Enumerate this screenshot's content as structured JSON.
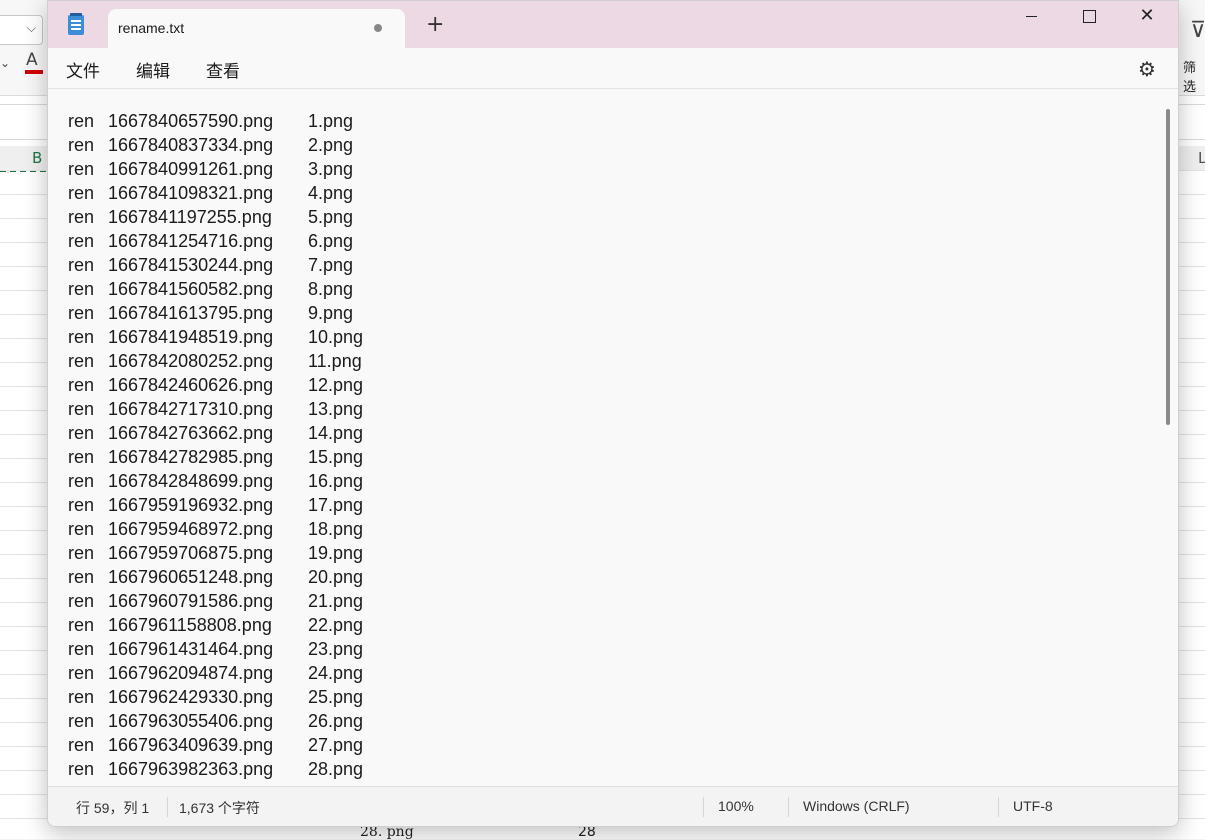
{
  "background_app": {
    "column_b": "B",
    "column_l": "L",
    "font_color_button": "A",
    "filter_label": "筛选",
    "cell_text": "28. png",
    "cell_number": "28"
  },
  "window": {
    "tab_title": "rename.txt",
    "new_tab_icon": "plus-icon",
    "controls": [
      "minimize-icon",
      "maximize-icon",
      "close-icon"
    ]
  },
  "menu": {
    "file": "文件",
    "edit": "编辑",
    "view": "查看"
  },
  "editor": {
    "lines": [
      {
        "cmd": "ren",
        "src": "1667840657590.png",
        "dst": "1.png"
      },
      {
        "cmd": "ren",
        "src": "1667840837334.png",
        "dst": "2.png"
      },
      {
        "cmd": "ren",
        "src": "1667840991261.png",
        "dst": "3.png"
      },
      {
        "cmd": "ren",
        "src": "1667841098321.png",
        "dst": "4.png"
      },
      {
        "cmd": "ren",
        "src": "1667841197255.png",
        "dst": "5.png"
      },
      {
        "cmd": "ren",
        "src": "1667841254716.png",
        "dst": "6.png"
      },
      {
        "cmd": "ren",
        "src": "1667841530244.png",
        "dst": "7.png"
      },
      {
        "cmd": "ren",
        "src": "1667841560582.png",
        "dst": "8.png"
      },
      {
        "cmd": "ren",
        "src": "1667841613795.png",
        "dst": "9.png"
      },
      {
        "cmd": "ren",
        "src": "1667841948519.png",
        "dst": "10.png"
      },
      {
        "cmd": "ren",
        "src": "1667842080252.png",
        "dst": "11.png"
      },
      {
        "cmd": "ren",
        "src": "1667842460626.png",
        "dst": "12.png"
      },
      {
        "cmd": "ren",
        "src": "1667842717310.png",
        "dst": "13.png"
      },
      {
        "cmd": "ren",
        "src": "1667842763662.png",
        "dst": "14.png"
      },
      {
        "cmd": "ren",
        "src": "1667842782985.png",
        "dst": "15.png"
      },
      {
        "cmd": "ren",
        "src": "1667842848699.png",
        "dst": "16.png"
      },
      {
        "cmd": "ren",
        "src": "1667959196932.png",
        "dst": "17.png"
      },
      {
        "cmd": "ren",
        "src": "1667959468972.png",
        "dst": "18.png"
      },
      {
        "cmd": "ren",
        "src": "1667959706875.png",
        "dst": "19.png"
      },
      {
        "cmd": "ren",
        "src": "1667960651248.png",
        "dst": "20.png"
      },
      {
        "cmd": "ren",
        "src": "1667960791586.png",
        "dst": "21.png"
      },
      {
        "cmd": "ren",
        "src": "1667961158808.png",
        "dst": "22.png"
      },
      {
        "cmd": "ren",
        "src": "1667961431464.png",
        "dst": "23.png"
      },
      {
        "cmd": "ren",
        "src": "1667962094874.png",
        "dst": "24.png"
      },
      {
        "cmd": "ren",
        "src": "1667962429330.png",
        "dst": "25.png"
      },
      {
        "cmd": "ren",
        "src": "1667963055406.png",
        "dst": "26.png"
      },
      {
        "cmd": "ren",
        "src": "1667963409639.png",
        "dst": "27.png"
      },
      {
        "cmd": "ren",
        "src": "1667963982363.png",
        "dst": "28.png"
      }
    ]
  },
  "statusbar": {
    "position": "行 59，列 1",
    "char_count": "1,673 个字符",
    "zoom": "100%",
    "line_ending": "Windows (CRLF)",
    "encoding": "UTF-8"
  }
}
